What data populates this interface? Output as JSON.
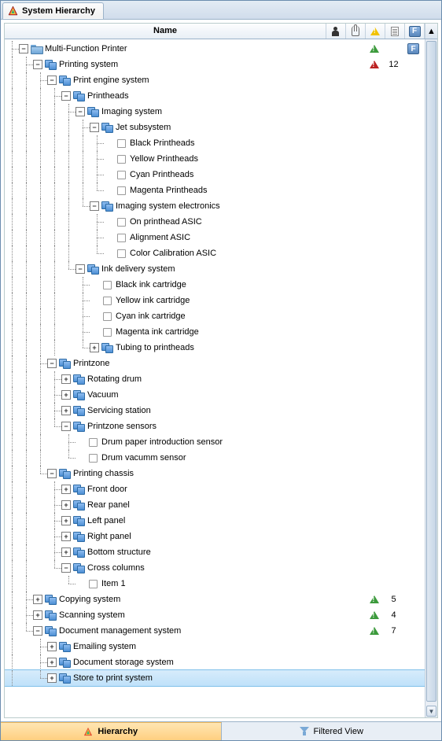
{
  "tab_title": "System Hierarchy",
  "columns": {
    "name": "Name"
  },
  "bottom_tabs": {
    "hierarchy": "Hierarchy",
    "filtered": "Filtered View"
  },
  "tree": [
    {
      "id": 0,
      "depth": 0,
      "exp": "-",
      "icon": "folder",
      "label": "Multi-Function Printer",
      "lines": [
        "h"
      ],
      "warn": "g",
      "fbadge": true
    },
    {
      "id": 1,
      "depth": 1,
      "exp": "-",
      "icon": "dbl",
      "label": "Printing system",
      "lines": [
        "v",
        "h"
      ],
      "warn": "r",
      "count": "12"
    },
    {
      "id": 2,
      "depth": 2,
      "exp": "-",
      "icon": "dbl",
      "label": "Print engine system",
      "lines": [
        "v",
        "v",
        "h"
      ]
    },
    {
      "id": 3,
      "depth": 3,
      "exp": "-",
      "icon": "dbl",
      "label": "Printheads",
      "lines": [
        "v",
        "v",
        "v",
        "h"
      ]
    },
    {
      "id": 4,
      "depth": 4,
      "exp": "-",
      "icon": "dbl",
      "label": "Imaging system",
      "lines": [
        "v",
        "v",
        "v",
        "v",
        "h"
      ]
    },
    {
      "id": 5,
      "depth": 5,
      "exp": "-",
      "icon": "dbl",
      "label": "Jet subsystem",
      "lines": [
        "v",
        "v",
        "v",
        "v",
        "v",
        "h"
      ]
    },
    {
      "id": 6,
      "depth": 6,
      "exp": "",
      "icon": "single",
      "label": "Black Printheads",
      "lines": [
        "v",
        "v",
        "v",
        "v",
        "v",
        "v",
        "h"
      ]
    },
    {
      "id": 7,
      "depth": 6,
      "exp": "",
      "icon": "single",
      "label": "Yellow Printheads",
      "lines": [
        "v",
        "v",
        "v",
        "v",
        "v",
        "v",
        "h"
      ]
    },
    {
      "id": 8,
      "depth": 6,
      "exp": "",
      "icon": "single",
      "label": "Cyan Printheads",
      "lines": [
        "v",
        "v",
        "v",
        "v",
        "v",
        "v",
        "h"
      ]
    },
    {
      "id": 9,
      "depth": 6,
      "exp": "",
      "icon": "single",
      "label": "Magenta Printheads",
      "lines": [
        "v",
        "v",
        "v",
        "v",
        "v",
        "v",
        "lh"
      ]
    },
    {
      "id": 10,
      "depth": 5,
      "exp": "-",
      "icon": "dbl",
      "label": "Imaging system electronics",
      "lines": [
        "v",
        "v",
        "v",
        "v",
        "v",
        "lh"
      ]
    },
    {
      "id": 11,
      "depth": 6,
      "exp": "",
      "icon": "single",
      "label": "On printhead ASIC",
      "lines": [
        "v",
        "v",
        "v",
        "v",
        "v",
        "n",
        "h"
      ]
    },
    {
      "id": 12,
      "depth": 6,
      "exp": "",
      "icon": "single",
      "label": "Alignment ASIC",
      "lines": [
        "v",
        "v",
        "v",
        "v",
        "v",
        "n",
        "h"
      ]
    },
    {
      "id": 13,
      "depth": 6,
      "exp": "",
      "icon": "single",
      "label": "Color Calibration ASIC",
      "lines": [
        "v",
        "v",
        "v",
        "v",
        "v",
        "n",
        "lh"
      ]
    },
    {
      "id": 14,
      "depth": 4,
      "exp": "-",
      "icon": "dbl",
      "label": "Ink delivery system",
      "lines": [
        "v",
        "v",
        "v",
        "v",
        "lh"
      ]
    },
    {
      "id": 15,
      "depth": 5,
      "exp": "",
      "icon": "single",
      "label": "Black ink cartridge",
      "lines": [
        "v",
        "v",
        "v",
        "v",
        "n",
        "h"
      ]
    },
    {
      "id": 16,
      "depth": 5,
      "exp": "",
      "icon": "single",
      "label": "Yellow ink cartridge",
      "lines": [
        "v",
        "v",
        "v",
        "v",
        "n",
        "h"
      ]
    },
    {
      "id": 17,
      "depth": 5,
      "exp": "",
      "icon": "single",
      "label": "Cyan ink cartridge",
      "lines": [
        "v",
        "v",
        "v",
        "v",
        "n",
        "h"
      ]
    },
    {
      "id": 18,
      "depth": 5,
      "exp": "",
      "icon": "single",
      "label": "Magenta ink cartridge",
      "lines": [
        "v",
        "v",
        "v",
        "v",
        "n",
        "h"
      ]
    },
    {
      "id": 19,
      "depth": 5,
      "exp": "+",
      "icon": "dbl",
      "label": "Tubing to printheads",
      "lines": [
        "v",
        "v",
        "v",
        "v",
        "n",
        "lh"
      ]
    },
    {
      "id": 20,
      "depth": 2,
      "exp": "-",
      "icon": "dbl",
      "label": "Printzone",
      "lines": [
        "v",
        "v",
        "h"
      ]
    },
    {
      "id": 21,
      "depth": 3,
      "exp": "+",
      "icon": "dbl",
      "label": "Rotating drum",
      "lines": [
        "v",
        "v",
        "v",
        "h"
      ]
    },
    {
      "id": 22,
      "depth": 3,
      "exp": "+",
      "icon": "dbl",
      "label": "Vacuum",
      "lines": [
        "v",
        "v",
        "v",
        "h"
      ]
    },
    {
      "id": 23,
      "depth": 3,
      "exp": "+",
      "icon": "dbl",
      "label": "Servicing station",
      "lines": [
        "v",
        "v",
        "v",
        "h"
      ]
    },
    {
      "id": 24,
      "depth": 3,
      "exp": "-",
      "icon": "dbl",
      "label": "Printzone sensors",
      "lines": [
        "v",
        "v",
        "v",
        "lh"
      ]
    },
    {
      "id": 25,
      "depth": 4,
      "exp": "",
      "icon": "single",
      "label": "Drum paper introduction sensor",
      "lines": [
        "v",
        "v",
        "v",
        "n",
        "h"
      ]
    },
    {
      "id": 26,
      "depth": 4,
      "exp": "",
      "icon": "single",
      "label": "Drum vacumm sensor",
      "lines": [
        "v",
        "v",
        "v",
        "n",
        "lh"
      ]
    },
    {
      "id": 27,
      "depth": 2,
      "exp": "-",
      "icon": "dbl",
      "label": "Printing chassis",
      "lines": [
        "v",
        "v",
        "lh"
      ]
    },
    {
      "id": 28,
      "depth": 3,
      "exp": "+",
      "icon": "dbl",
      "label": "Front door",
      "lines": [
        "v",
        "v",
        "n",
        "h"
      ]
    },
    {
      "id": 29,
      "depth": 3,
      "exp": "+",
      "icon": "dbl",
      "label": "Rear panel",
      "lines": [
        "v",
        "v",
        "n",
        "h"
      ]
    },
    {
      "id": 30,
      "depth": 3,
      "exp": "+",
      "icon": "dbl",
      "label": "Left panel",
      "lines": [
        "v",
        "v",
        "n",
        "h"
      ]
    },
    {
      "id": 31,
      "depth": 3,
      "exp": "+",
      "icon": "dbl",
      "label": "Right panel",
      "lines": [
        "v",
        "v",
        "n",
        "h"
      ]
    },
    {
      "id": 32,
      "depth": 3,
      "exp": "+",
      "icon": "dbl",
      "label": "Bottom structure",
      "lines": [
        "v",
        "v",
        "n",
        "h"
      ]
    },
    {
      "id": 33,
      "depth": 3,
      "exp": "-",
      "icon": "dbl",
      "label": "Cross columns",
      "lines": [
        "v",
        "v",
        "n",
        "lh"
      ]
    },
    {
      "id": 34,
      "depth": 4,
      "exp": "",
      "icon": "single",
      "label": "Item 1",
      "lines": [
        "v",
        "v",
        "n",
        "n",
        "lh"
      ]
    },
    {
      "id": 35,
      "depth": 1,
      "exp": "+",
      "icon": "dbl",
      "label": "Copying system",
      "lines": [
        "v",
        "h"
      ],
      "warn": "g",
      "count": "5"
    },
    {
      "id": 36,
      "depth": 1,
      "exp": "+",
      "icon": "dbl",
      "label": "Scanning system",
      "lines": [
        "v",
        "h"
      ],
      "warn": "g",
      "count": "4"
    },
    {
      "id": 37,
      "depth": 1,
      "exp": "-",
      "icon": "dbl",
      "label": "Document management system",
      "lines": [
        "v",
        "lh"
      ],
      "warn": "g",
      "count": "7"
    },
    {
      "id": 38,
      "depth": 2,
      "exp": "+",
      "icon": "dbl",
      "label": "Emailing system",
      "lines": [
        "v",
        "n",
        "h"
      ]
    },
    {
      "id": 39,
      "depth": 2,
      "exp": "+",
      "icon": "dbl",
      "label": "Document storage system",
      "lines": [
        "v",
        "n",
        "h"
      ]
    },
    {
      "id": 40,
      "depth": 2,
      "exp": "+",
      "icon": "dbl",
      "label": "Store to print system",
      "lines": [
        "v",
        "n",
        "lh"
      ],
      "selected": true
    }
  ]
}
